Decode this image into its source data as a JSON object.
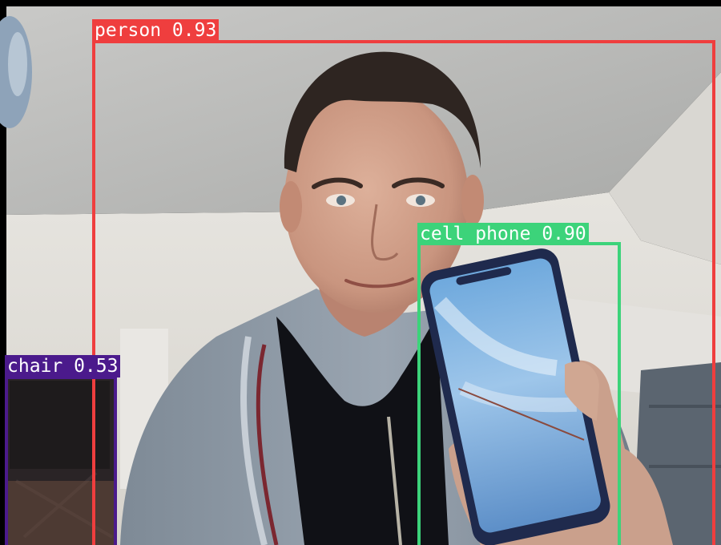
{
  "detections": [
    {
      "class": "person",
      "score": "0.93",
      "label": "person 0.93",
      "color": "#ef3e3e"
    },
    {
      "class": "cell phone",
      "score": "0.90",
      "label": "cell phone 0.90",
      "color": "#3cd37a"
    },
    {
      "class": "chair",
      "score": "0.53",
      "label": "chair 0.53",
      "color": "#4b1a8c"
    }
  ],
  "colors": {
    "person_box": "#ef3e3e",
    "phone_box": "#3cd37a",
    "chair_box": "#4b1a8c",
    "label_text": "#ffffff"
  }
}
